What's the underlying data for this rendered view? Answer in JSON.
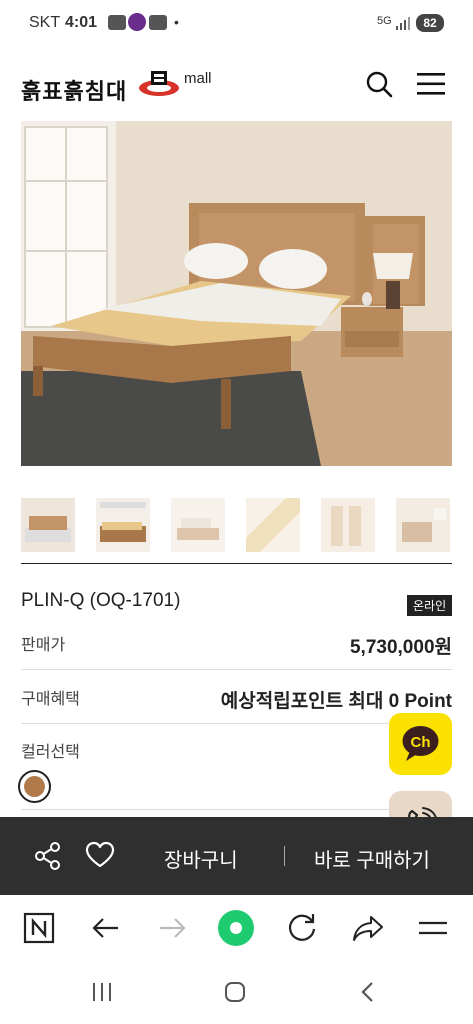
{
  "status_bar": {
    "carrier": "SKT",
    "time": "4:01",
    "network": "5G",
    "battery": "82"
  },
  "header": {
    "brand_text": "흙표흙침대",
    "brand_sub": "mall",
    "icons": [
      "search-icon",
      "menu-icon"
    ]
  },
  "product": {
    "name": "PLIN-Q (OQ-1701)",
    "badge": "온라인",
    "price_label": "판매가",
    "price_value": "5,730,000원",
    "benefit_label": "구매혜택",
    "benefit_value": "예상적립포인트 최대 0 Point",
    "color_label": "컬러선택",
    "selected_color": "#b07a4a",
    "thumbnail_count": 6
  },
  "floating": {
    "chat_label": "Ch",
    "chat_color": "#fae100",
    "call_icon": "phone-call-icon"
  },
  "action_bar": {
    "share_icon": "share-icon",
    "wish_icon": "heart-icon",
    "cart_label": "장바구니",
    "buy_label": "바로 구매하기"
  },
  "browser_bar": {
    "icons": [
      "naver-icon",
      "back-arrow-icon",
      "forward-arrow-icon",
      "home-dot-icon",
      "refresh-icon",
      "share-arrow-icon",
      "menu-icon"
    ]
  },
  "nav_bar": {
    "icons": [
      "recent-apps-icon",
      "home-icon",
      "back-icon"
    ]
  }
}
